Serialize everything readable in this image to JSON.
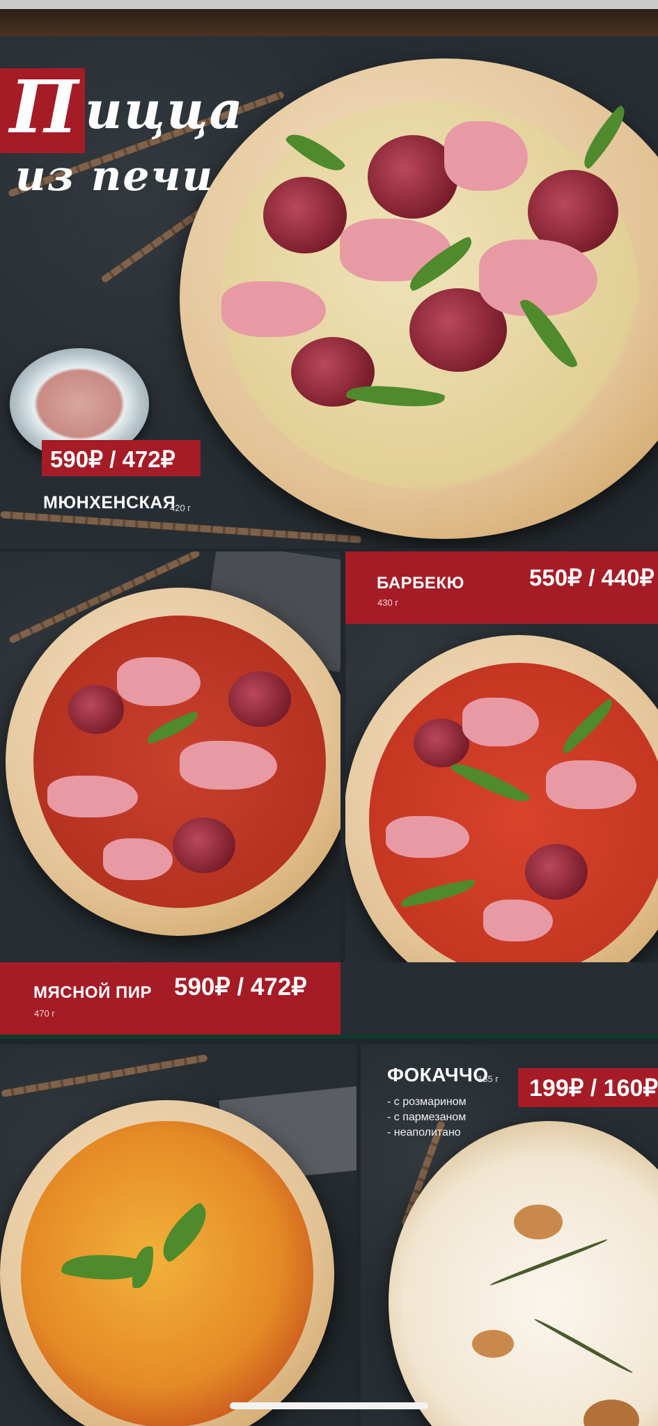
{
  "header": {
    "title_first_letter": "П",
    "title_rest": "ицца",
    "title_line2": "из печи"
  },
  "items": [
    {
      "name": "МЮНХЕНСКАЯ",
      "weight": "420 г",
      "price": "590₽ / 472₽"
    },
    {
      "name": "БАРБЕКЮ",
      "weight": "430 г",
      "price": "550₽ / 440₽"
    },
    {
      "name": "МЯСНОЙ ПИР",
      "weight": "470 г",
      "price": "590₽ / 472₽"
    },
    {
      "name": "ФОКАЧЧО",
      "weight": "185 г",
      "price": "199₽ / 160₽",
      "options": [
        "- с розмарином",
        "- с пармезаном",
        "- неаполитано"
      ]
    }
  ],
  "colors": {
    "accent_red": "#a51c26",
    "background_dark": "#272e33",
    "text_white": "#ffffff"
  }
}
